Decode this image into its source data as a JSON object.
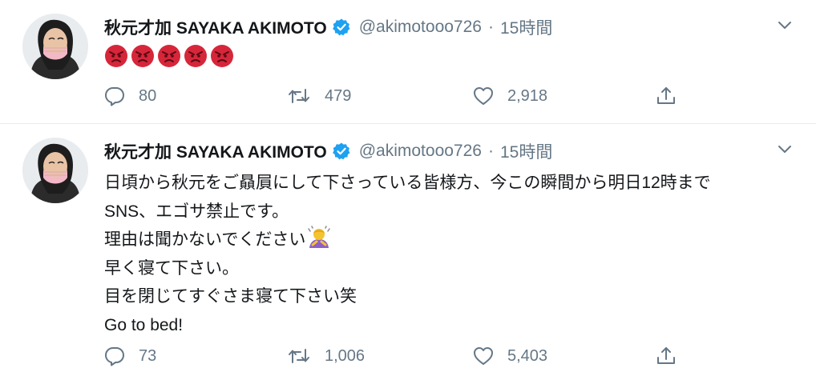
{
  "tweets": [
    {
      "author_name": "秋元才加 SAYAKA AKIMOTO",
      "handle": "@akimotooo726",
      "separator": "·",
      "time": "15時間",
      "emojis": [
        "angry-face",
        "angry-face",
        "angry-face",
        "angry-face",
        "angry-face"
      ],
      "replies": "80",
      "retweets": "479",
      "likes": "2,918"
    },
    {
      "author_name": "秋元才加 SAYAKA AKIMOTO",
      "handle": "@akimotooo726",
      "separator": "·",
      "time": "15時間",
      "text_lines": [
        "日頃から秋元をご贔屓にして下さっている皆様方、今この瞬間から明日12時まで",
        "SNS、エゴサ禁止です。",
        "理由は聞かないでください",
        "早く寝て下さい。",
        "目を閉じてすぐさま寝て下さい笑",
        "Go to bed!"
      ],
      "inline_emoji": "person-bowing",
      "replies": "73",
      "retweets": "1,006",
      "likes": "5,403"
    }
  ],
  "colors": {
    "verified": "#1da1f2",
    "secondary_text": "#657786",
    "divider": "#e6ecf0",
    "angry_emoji": "#d6263a"
  }
}
